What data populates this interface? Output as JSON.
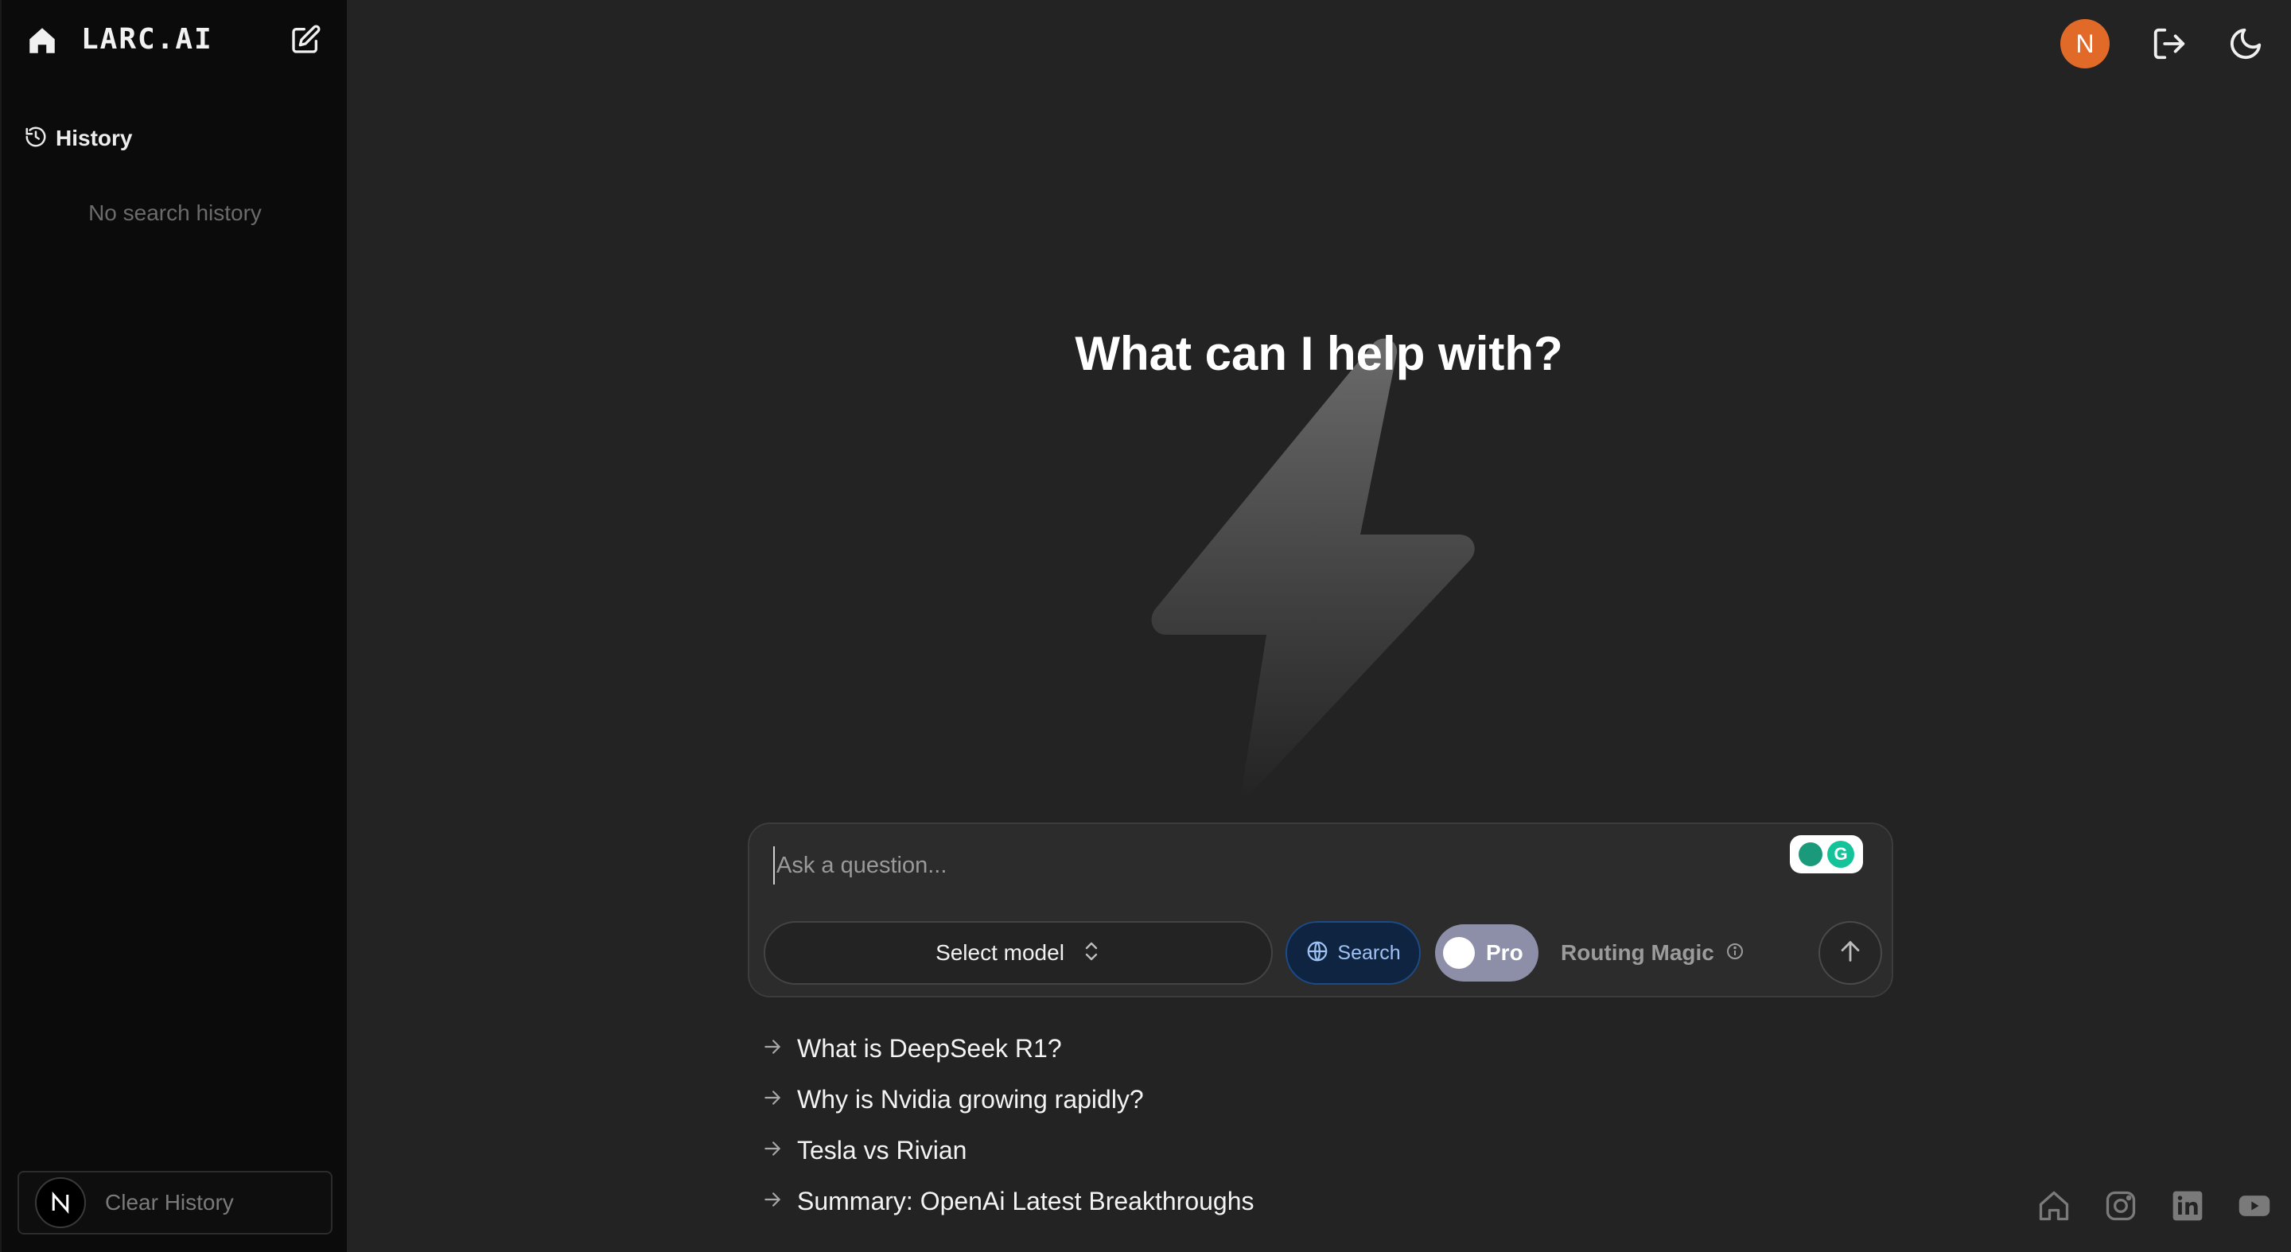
{
  "sidebar": {
    "logo": "LARC.AI",
    "history_label": "History",
    "empty_text": "No search history",
    "clear_label": "Clear History",
    "user_initial": "N",
    "icons": [
      "home-icon",
      "edit-icon",
      "history-icon"
    ]
  },
  "header": {
    "avatar_initial": "N",
    "avatar_color": "#e26a28",
    "icons": [
      "logout-icon",
      "moon-icon"
    ]
  },
  "main": {
    "title": "What can I help with?"
  },
  "composer": {
    "placeholder": "Ask a question...",
    "model_label": "Select model",
    "search_label": "Search",
    "pro_label": "Pro",
    "routing_label": "Routing Magic"
  },
  "suggestions": [
    "What is DeepSeek R1?",
    "Why is Nvidia growing rapidly?",
    "Tesla vs Rivian",
    "Summary: OpenAi Latest Breakthroughs"
  ],
  "footer": {
    "icons": [
      "home-icon",
      "instagram-icon",
      "linkedin-icon",
      "youtube-icon"
    ]
  },
  "colors": {
    "background": "#232323",
    "sidebar": "#0b0b0b",
    "accent_blue": "#1c4a86"
  }
}
